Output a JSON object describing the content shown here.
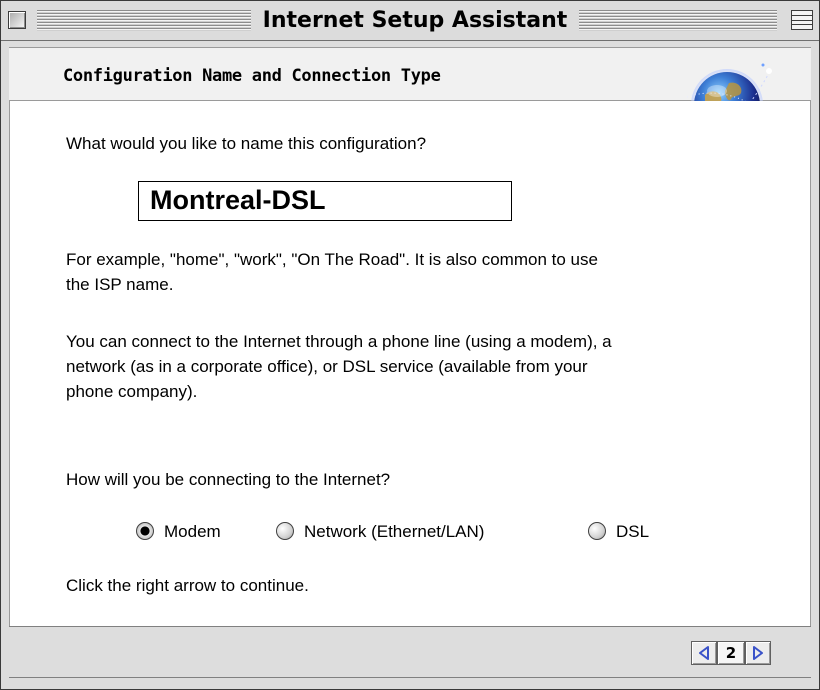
{
  "window": {
    "title": "Internet Setup Assistant"
  },
  "header": {
    "title": "Configuration Name and Connection Type",
    "globe_icon": "globe-icon"
  },
  "content": {
    "name_prompt": "What would you like to name this configuration?",
    "name_value": "Montreal-DSL",
    "example_line1": "For example, \"home\", \"work\", \"On The Road\".  It is also common to use",
    "example_line2": "the ISP name.",
    "connect_line1": "You can connect to the Internet through a phone line (using a modem), a",
    "connect_line2": "network (as in a corporate office), or DSL service (available from your",
    "connect_line3": "phone company).",
    "connection_question": "How will you be connecting to the Internet?",
    "connection_options": [
      {
        "label": "Modem",
        "selected": true
      },
      {
        "label": "Network (Ethernet/LAN)",
        "selected": false
      },
      {
        "label": "DSL",
        "selected": false
      }
    ],
    "continue_hint": "Click the right arrow to continue."
  },
  "footer": {
    "page_number": "2",
    "arrow_color": "#3a52c9"
  }
}
